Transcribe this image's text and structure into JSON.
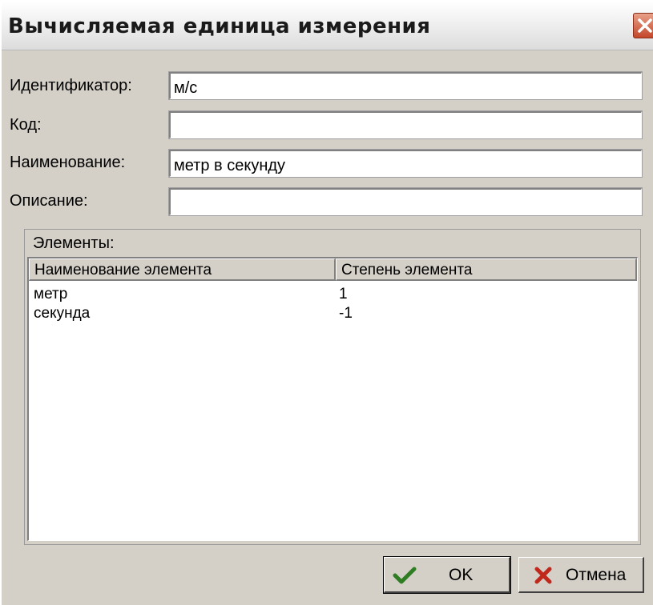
{
  "window": {
    "title": "Вычисляемая единица измерения"
  },
  "form": {
    "identifier_label": "Идентификатор:",
    "identifier_value": "м/с",
    "code_label": "Код:",
    "code_value": "",
    "name_label": "Наименование:",
    "name_value": "метр в секунду",
    "description_label": "Описание:",
    "description_value": ""
  },
  "elements": {
    "group_label": "Элементы:",
    "columns": [
      "Наименование элемента",
      "Степень элемента"
    ],
    "rows": [
      {
        "name": "метр",
        "power": "1"
      },
      {
        "name": "секунда",
        "power": "-1"
      }
    ]
  },
  "buttons": {
    "ok_label": "OK",
    "cancel_label": "Отмена"
  },
  "icons": {
    "close": "close-icon",
    "ok": "checkmark-icon",
    "cancel": "cross-icon"
  },
  "colors": {
    "dialog_bg": "#d4d0c8",
    "close_button": "#c4472a",
    "ok_icon": "#2f7d23",
    "cancel_icon": "#c0281c"
  }
}
